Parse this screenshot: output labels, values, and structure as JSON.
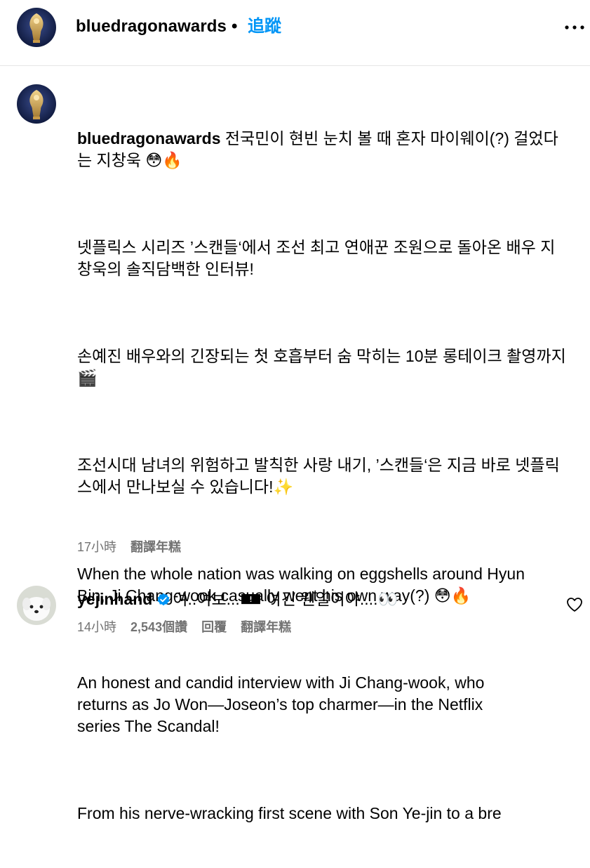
{
  "post_header": {
    "username": "bluedragonawards",
    "dot": "•",
    "follow_label": "追蹤",
    "more_icon": "more-horizontal-icon"
  },
  "caption": {
    "username": "bluedragonawards",
    "paragraphs": [
      " 전국민이 현빈 눈치 볼 때 혼자 마이웨이(?) 걸었다\n는 지창욱 😳🔥",
      "넷플릭스 시리즈 ’스캔들‘에서 조선 최고 연애꾼 조원으로 돌아온 배우 지\n창욱의 솔직담백한 인터뷰!",
      "손예진 배우와의 긴장되는 첫 호흡부터 숨 막히는 10분 롱테이크 촬영까지\n🎬",
      "조선시대 남녀의 위험하고 발칙한 사랑 내기, ’스캔들‘은 지금 바로 넷플릭\n스에서 만나보실 수 있습니다!✨",
      "When the whole nation was walking on eggshells around Hyun\nBin, Ji Chang-wook casually went his own way(?) 😳🔥",
      "An honest and candid interview with Ji Chang-wook, who\nreturns as Jo Won—Joseon’s top charmer—in the Netflix\nseries The Scandal!",
      "From his nerve-wracking first scene with Son Ye-jin to a bre"
    ],
    "time": "17小時",
    "translate_label": "翻譯年糕"
  },
  "comment": {
    "username": "yejinhand",
    "verified_icon": "verified-badge-icon",
    "text": "여..여보...🀰 여긴 웬일이야....👀",
    "time": "14小時",
    "likes": "2,543個讚",
    "reply_label": "回覆",
    "translate_label": "翻譯年糕",
    "like_icon": "heart-outline-icon"
  },
  "colors": {
    "text": "#000000",
    "secondary": "#737373",
    "link": "#0095f6",
    "verified": "#0095f6",
    "divider": "#e6e6e6"
  }
}
